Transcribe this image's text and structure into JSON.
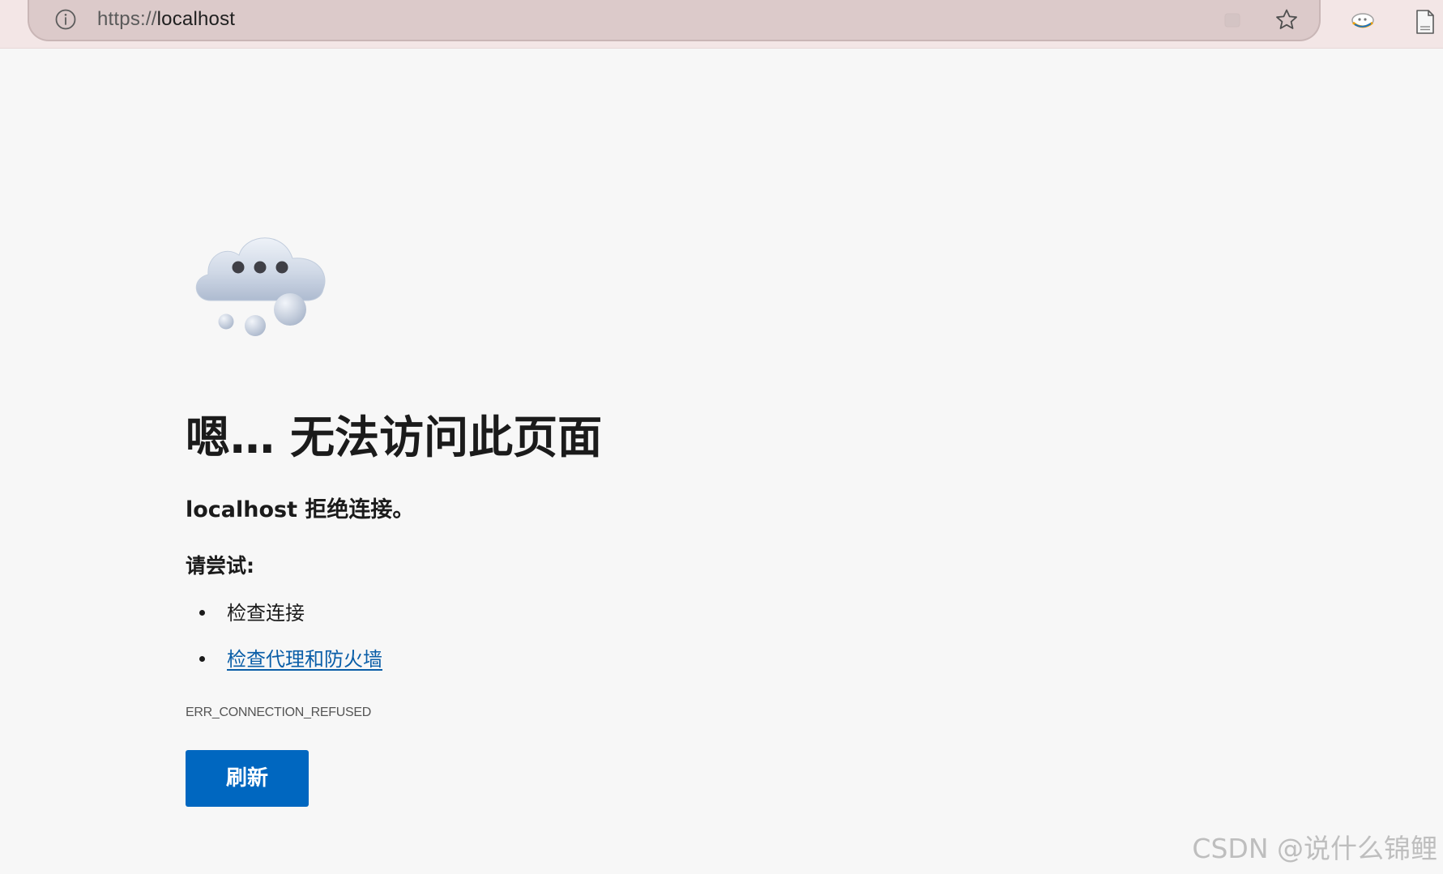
{
  "browser": {
    "url_scheme": "https://",
    "url_host": "localhost",
    "icons": {
      "site_info": "info-circle-icon",
      "extension_dim": "extension-icon",
      "favorite": "star-icon",
      "profile_extension": "extension-icon",
      "page": "document-icon"
    }
  },
  "error_page": {
    "illustration": "cloud-icon",
    "heading": "嗯… 无法访问此页面",
    "subheading": "localhost 拒绝连接。",
    "try_label": "请尝试:",
    "suggestions": [
      {
        "label": "检查连接",
        "is_link": false
      },
      {
        "label": "检查代理和防火墙",
        "is_link": true
      }
    ],
    "error_code": "ERR_CONNECTION_REFUSED",
    "refresh_label": "刷新"
  },
  "watermark": "CSDN @说什么锦鲤",
  "colors": {
    "accent": "#0067c0",
    "link": "#0a5ea8",
    "background": "#f7f7f7",
    "toolbar": "#f3e6e6"
  }
}
